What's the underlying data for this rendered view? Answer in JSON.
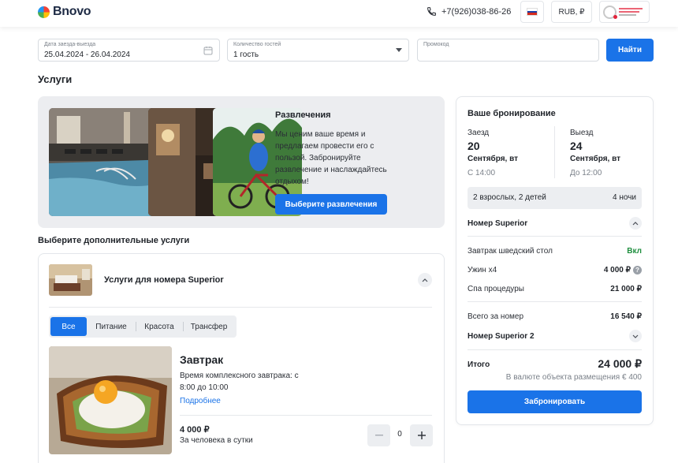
{
  "header": {
    "logo_text": "Bnovo",
    "phone": "+7(926)038-86-26",
    "currency": "RUB, ₽",
    "language_flag": "russian-flag"
  },
  "search": {
    "dates_label": "Дата заезда-выезда",
    "dates_value": "25.04.2024 - 26.04.2024",
    "guests_label": "Количество гостей",
    "guests_value": "1 гость",
    "promo_label": "Промокод",
    "promo_value": "",
    "button": "Найти"
  },
  "page": {
    "title": "Услуги",
    "subtitle": "Выберите дополнительные услуги"
  },
  "entertainment": {
    "title": "Развлечения",
    "description": "Мы ценим ваше время и предлагаем провести его с пользой. Забронируйте развлечение и наслаждайтесь отдыхом!",
    "button": "Выберите развлечения"
  },
  "services": {
    "room_title": "Услуги для номера Superior",
    "tabs": [
      "Все",
      "Питание",
      "Красота",
      "Трансфер"
    ],
    "active_tab": 0,
    "item": {
      "title": "Завтрак",
      "description": "Время комплексного завтрака: с 8:00 до 10:00",
      "more_link": "Подробнее",
      "price": "4 000 ₽",
      "unit": "За человека в сутки",
      "quantity": "0"
    }
  },
  "booking": {
    "title": "Ваше бронирование",
    "checkin_label": "Заезд",
    "checkin_day": "20",
    "checkin_date": "Сентября, вт",
    "checkin_time": "С 14:00",
    "checkout_label": "Выезд",
    "checkout_day": "24",
    "checkout_date": "Сентября, вт",
    "checkout_time": "До 12:00",
    "guests": "2 взрослых, 2 детей",
    "nights": "4 ночи",
    "room1": "Номер Superior",
    "lines": [
      {
        "label": "Завтрак шведский стол",
        "value": "Вкл"
      },
      {
        "label": "Ужин x4",
        "value": "4 000 ₽"
      },
      {
        "label": "Спа процедуры",
        "value": "21 000 ₽"
      }
    ],
    "room_total_label": "Всего за номер",
    "room_total_value": "16 540 ₽",
    "room2": "Номер Superior 2",
    "total_label": "Итого",
    "total_value": "24 000 ₽",
    "total_currency_note": "В валюте объекта размещения € 400",
    "button": "Забронировать"
  },
  "colors": {
    "accent": "#1a73e8",
    "included": "#1e8e3e",
    "banner_bg": "#ecedf0"
  }
}
